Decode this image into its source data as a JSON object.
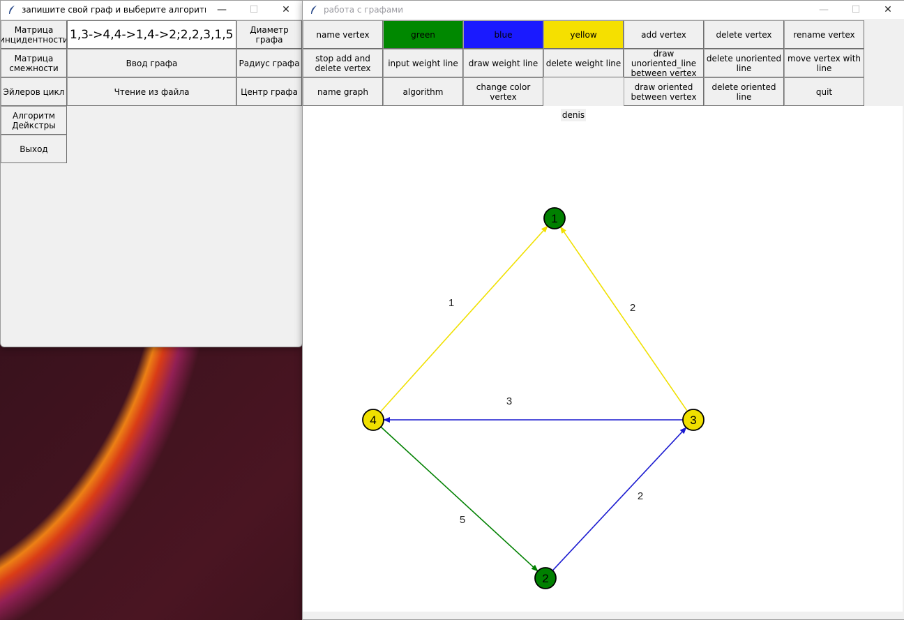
{
  "left_window": {
    "title": "запишите свой граф и выберите алгоритм",
    "buttons": {
      "incidence": "Матрица инцидентности",
      "adjacency": "Матрица смежности",
      "euler": "Эйлеров цикл",
      "dijkstra": "Алгоритм Дейкстры",
      "exit": "Выход",
      "input_graph": "Ввод графа",
      "read_file": "Чтение из файла",
      "diameter": "Диаметр графа",
      "radius": "Радиус графа",
      "center": "Центр графа"
    },
    "graph_input_value": "1,3->4,4->1,4->2;2,2,3,1,5"
  },
  "right_window": {
    "title": "работа с графами",
    "toolbar": {
      "row1": [
        "name vertex",
        "green",
        "blue",
        "yellow",
        "add vertex",
        "delete vertex",
        "rename vertex"
      ],
      "row2": [
        "stop add and delete vertex",
        "input weight line",
        "draw weight line",
        "delete weight line",
        "draw unoriented_line between vertex",
        "delete unoriented line",
        "move vertex with line"
      ],
      "row3": [
        "name graph",
        "algorithm",
        "change color vertex",
        "",
        "draw oriented between vertex",
        "delete oriented line",
        "quit"
      ]
    },
    "color_buttons": {
      "green": "#008800",
      "blue": "#1a1aff",
      "yellow": "#f5e000"
    },
    "graph_name": "denis",
    "graph": {
      "vertices": [
        {
          "id": "1",
          "color": "#008000"
        },
        {
          "id": "2",
          "color": "#008000"
        },
        {
          "id": "3",
          "color": "#f0e000"
        },
        {
          "id": "4",
          "color": "#f0e000"
        }
      ],
      "edges": [
        {
          "from": "4",
          "to": "1",
          "weight": "1",
          "color": "#f0e000"
        },
        {
          "from": "3",
          "to": "1",
          "weight": "2",
          "color": "#f0e000"
        },
        {
          "from": "3",
          "to": "4",
          "weight": "3",
          "color": "#1a1ad0"
        },
        {
          "from": "2",
          "to": "3",
          "weight": "2",
          "color": "#1a1ad0"
        },
        {
          "from": "4",
          "to": "2",
          "weight": "5",
          "color": "#008000"
        }
      ]
    }
  }
}
